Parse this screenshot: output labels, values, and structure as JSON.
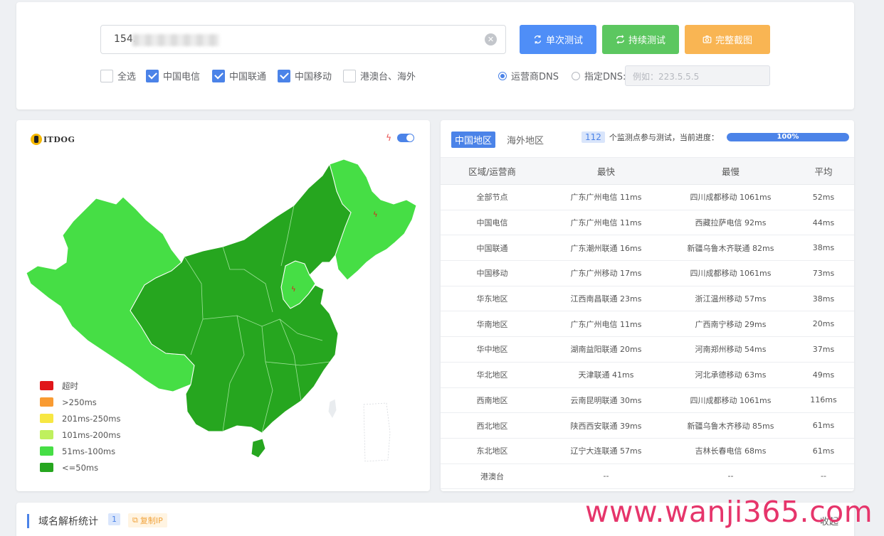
{
  "query": {
    "ip_prefix": "154.",
    "buttons": {
      "single_test": "单次测试",
      "continuous_test": "持续测试",
      "full_screenshot": "完整截图"
    },
    "isp_filters": [
      {
        "label": "全选",
        "checked": false
      },
      {
        "label": "中国电信",
        "checked": true
      },
      {
        "label": "中国联通",
        "checked": true
      },
      {
        "label": "中国移动",
        "checked": true
      },
      {
        "label": "港澳台、海外",
        "checked": false
      }
    ],
    "dns": {
      "carrier_label": "运营商DNS",
      "custom_label": "指定DNS:",
      "selected": "carrier",
      "placeholder": "例如：223.5.5.5"
    }
  },
  "map": {
    "logo_text": "ITDOG",
    "legend": [
      {
        "label": "超时",
        "color": "#e0161a"
      },
      {
        "label": ">250ms",
        "color": "#f99b32"
      },
      {
        "label": "201ms-250ms",
        "color": "#f7e743"
      },
      {
        "label": "101ms-200ms",
        "color": "#bff05e"
      },
      {
        "label": "51ms-100ms",
        "color": "#46de45"
      },
      {
        "label": "<=50ms",
        "color": "#26a61f"
      }
    ]
  },
  "stats": {
    "tabs": [
      "中国地区",
      "海外地区"
    ],
    "node_count": "112",
    "progress_text": "个监测点参与测试，当前进度：",
    "progress_value": "100%",
    "progress_fraction": 1.0,
    "columns": [
      "区域/运营商",
      "最快",
      "最慢",
      "平均"
    ],
    "rows": [
      [
        "全部节点",
        "广东广州电信 11ms",
        "四川成都移动 1061ms",
        "52ms"
      ],
      [
        "中国电信",
        "广东广州电信 11ms",
        "西藏拉萨电信 92ms",
        "44ms"
      ],
      [
        "中国联通",
        "广东潮州联通 16ms",
        "新疆乌鲁木齐联通 82ms",
        "38ms"
      ],
      [
        "中国移动",
        "广东广州移动 17ms",
        "四川成都移动 1061ms",
        "73ms"
      ],
      [
        "华东地区",
        "江西南昌联通 23ms",
        "浙江温州移动 57ms",
        "38ms"
      ],
      [
        "华南地区",
        "广东广州电信 11ms",
        "广西南宁移动 29ms",
        "20ms"
      ],
      [
        "华中地区",
        "湖南益阳联通 20ms",
        "河南郑州移动 54ms",
        "37ms"
      ],
      [
        "华北地区",
        "天津联通 41ms",
        "河北承德移动 63ms",
        "49ms"
      ],
      [
        "西南地区",
        "云南昆明联通 30ms",
        "四川成都移动 1061ms",
        "116ms"
      ],
      [
        "西北地区",
        "陕西西安联通 39ms",
        "新疆乌鲁木齐移动 85ms",
        "61ms"
      ],
      [
        "东北地区",
        "辽宁大连联通 57ms",
        "吉林长春电信 68ms",
        "61ms"
      ],
      [
        "港澳台",
        "--",
        "--",
        "--"
      ]
    ]
  },
  "dns_stats": {
    "title": "域名解析统计",
    "count": "1",
    "copy_label": "复制IP",
    "collapse_label": "收起"
  },
  "watermark": "www.wanji365.com"
}
